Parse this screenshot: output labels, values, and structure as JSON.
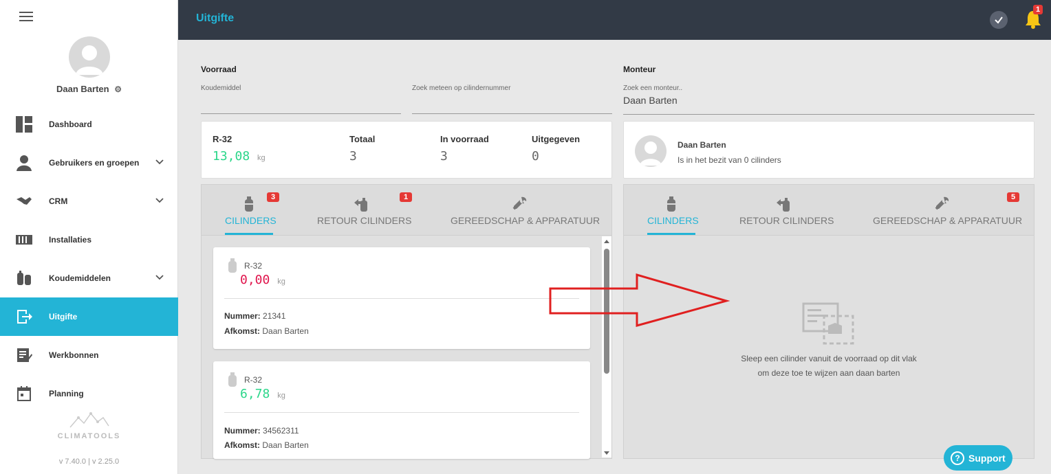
{
  "sidebar": {
    "user_name": "Daan Barten",
    "items": [
      {
        "label": "Dashboard",
        "icon": "dashboard-icon",
        "expandable": false,
        "active": false
      },
      {
        "label": "Gebruikers en groepen",
        "icon": "users-icon",
        "expandable": true,
        "active": false
      },
      {
        "label": "CRM",
        "icon": "handshake-icon",
        "expandable": true,
        "active": false
      },
      {
        "label": "Installaties",
        "icon": "radiator-icon",
        "expandable": false,
        "active": false
      },
      {
        "label": "Koudemiddelen",
        "icon": "cylinders-icon",
        "expandable": true,
        "active": false
      },
      {
        "label": "Uitgifte",
        "icon": "exit-icon",
        "expandable": false,
        "active": true
      },
      {
        "label": "Werkbonnen",
        "icon": "workorder-icon",
        "expandable": false,
        "active": false
      },
      {
        "label": "Planning",
        "icon": "calendar-icon",
        "expandable": false,
        "active": false
      }
    ],
    "logo_text": "CLIMATOOLS",
    "version": "v 7.40.0  | v 2.25.0"
  },
  "header": {
    "title": "Uitgifte",
    "notification_count": "1"
  },
  "voorraad": {
    "title": "Voorraad",
    "koudemiddel_label": "Koudemiddel",
    "koudemiddel_value": "",
    "search_label": "Zoek meteen op cilindernummer",
    "search_value": "",
    "summary": {
      "refrigerant": "R-32",
      "amount": "13,08",
      "unit": "kg",
      "totaal_label": "Totaal",
      "totaal_value": "3",
      "voorraad_label": "In voorraad",
      "voorraad_value": "3",
      "uitgegeven_label": "Uitgegeven",
      "uitgegeven_value": "0"
    },
    "tabs": [
      {
        "label": "CILINDERS",
        "badge": "3",
        "active": true
      },
      {
        "label": "RETOUR CILINDERS",
        "badge": "1",
        "active": false
      },
      {
        "label": "GEREEDSCHAP & APPARATUUR",
        "badge": "",
        "active": false
      }
    ],
    "cylinders": [
      {
        "type": "R-32",
        "kg": "0,00",
        "unit": "kg",
        "nummer_label": "Nummer:",
        "nummer": "21341",
        "afkomst_label": "Afkomst:",
        "afkomst": "Daan Barten",
        "status_color": "#e0144c"
      },
      {
        "type": "R-32",
        "kg": "6,78",
        "unit": "kg",
        "nummer_label": "Nummer:",
        "nummer": "34562311",
        "afkomst_label": "Afkomst:",
        "afkomst": "Daan Barten",
        "status_color": "#2bd68a"
      }
    ]
  },
  "monteur": {
    "title": "Monteur",
    "search_label": "Zoek een monteur..",
    "search_value": "Daan Barten",
    "name": "Daan Barten",
    "bezit": "Is in het bezit van 0 cilinders",
    "tabs": [
      {
        "label": "CILINDERS",
        "badge": "",
        "active": true
      },
      {
        "label": "RETOUR CILINDERS",
        "badge": "",
        "active": false
      },
      {
        "label": "GEREEDSCHAP & APPARATUUR",
        "badge": "5",
        "active": false
      }
    ],
    "drop_line1": "Sleep een cilinder vanuit de voorraad op dit vlak",
    "drop_line2": "om deze toe te wijzen aan daan barten"
  },
  "support_label": "Support",
  "colors": {
    "accent": "#23b4d6",
    "header_bg": "#323a46",
    "badge": "#e53935",
    "green": "#2bd68a",
    "red": "#e0144c"
  }
}
